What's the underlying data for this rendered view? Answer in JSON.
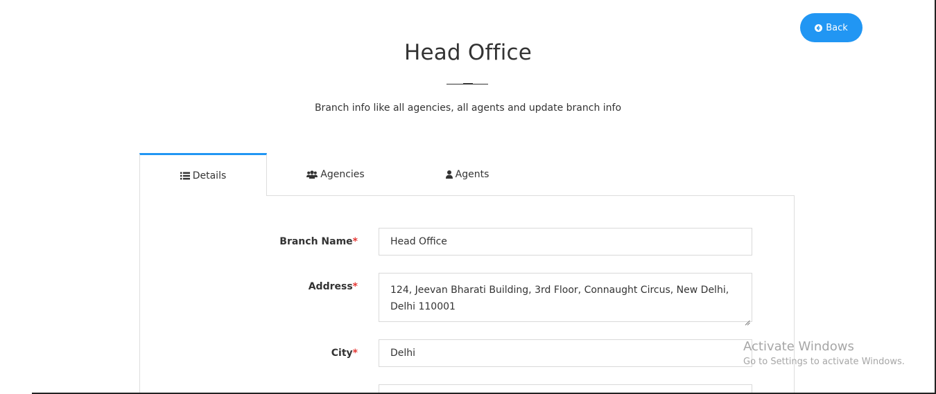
{
  "header": {
    "back_label": "Back",
    "title": "Head Office",
    "subtitle": "Branch info like all agencies, all agents and update branch info"
  },
  "tabs": [
    {
      "label": "Details",
      "icon": "list-icon",
      "active": true
    },
    {
      "label": "Agencies",
      "icon": "users-icon",
      "active": false
    },
    {
      "label": "Agents",
      "icon": "user-icon",
      "active": false
    }
  ],
  "form": {
    "required_mark": "*",
    "branch_name": {
      "label": "Branch Name",
      "value": "Head Office"
    },
    "address": {
      "label": "Address",
      "value": "124, Jeevan Bharati Building, 3rd Floor, Connaught Circus, New Delhi, Delhi 110001"
    },
    "city": {
      "label": "City",
      "value": "Delhi"
    },
    "next_field": {
      "value": ""
    }
  },
  "watermark": {
    "title": "Activate Windows",
    "subtitle": "Go to Settings to activate Windows."
  },
  "colors": {
    "accent": "#2196f3",
    "required": "#e53935",
    "border": "#dddddd"
  }
}
